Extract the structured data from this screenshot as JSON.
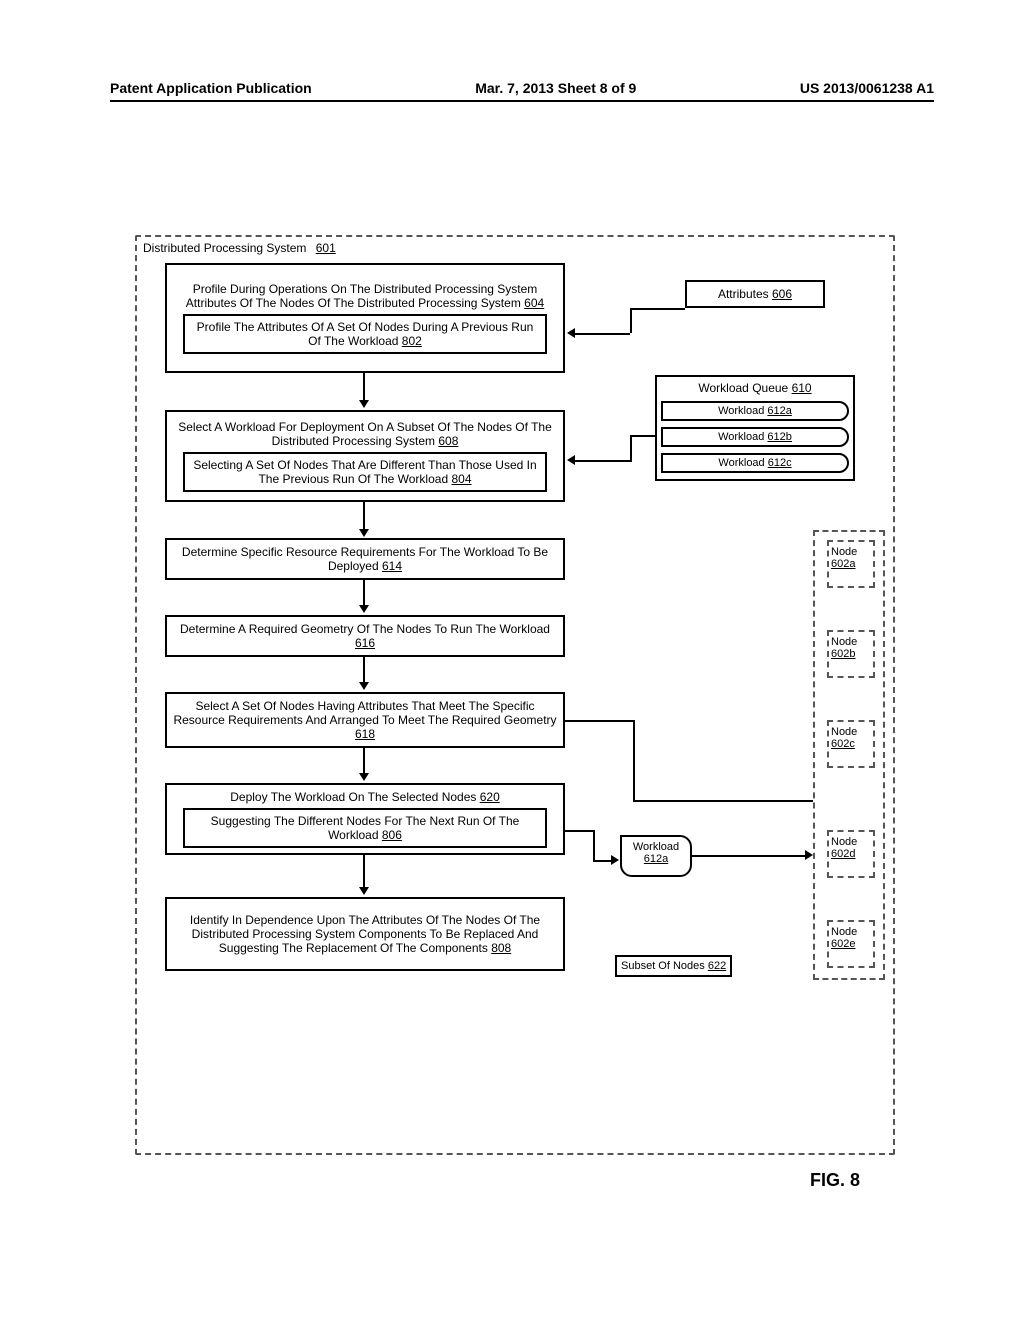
{
  "header": {
    "left": "Patent Application Publication",
    "center": "Mar. 7, 2013  Sheet 8 of 9",
    "right": "US 2013/0061238 A1"
  },
  "system_label": "Distributed Processing System",
  "system_ref": "601",
  "boxes": {
    "b604": "Profile During Operations On The Distributed Processing System Attributes Of The Nodes Of The Distributed Processing System",
    "b604_ref": "604",
    "b802": "Profile The Attributes Of A Set Of Nodes During A Previous Run Of The Workload",
    "b802_ref": "802",
    "b608": "Select A Workload For Deployment On A Subset Of The Nodes Of The Distributed Processing System",
    "b608_ref": "608",
    "b804": "Selecting A Set Of Nodes That Are Different Than Those Used In The Previous Run Of The Workload",
    "b804_ref": "804",
    "b614": "Determine Specific Resource Requirements For The Workload To Be Deployed",
    "b614_ref": "614",
    "b616": "Determine A Required Geometry Of The Nodes To Run The Workload",
    "b616_ref": "616",
    "b618": "Select A Set Of Nodes Having Attributes That Meet The Specific Resource Requirements And Arranged To Meet The Required Geometry",
    "b618_ref": "618",
    "b620": "Deploy The Workload On The Selected Nodes",
    "b620_ref": "620",
    "b806": "Suggesting The Different Nodes For The Next Run Of The Workload",
    "b806_ref": "806",
    "b808": "Identify In Dependence Upon The Attributes Of The Nodes Of The Distributed Processing System Components To Be Replaced And Suggesting The Replacement Of The Components",
    "b808_ref": "808"
  },
  "attributes": {
    "label": "Attributes",
    "ref": "606"
  },
  "queue": {
    "label": "Workload Queue",
    "ref": "610",
    "items": [
      {
        "label": "Workload",
        "ref": "612a"
      },
      {
        "label": "Workload",
        "ref": "612b"
      },
      {
        "label": "Workload",
        "ref": "612c"
      }
    ]
  },
  "nodes": {
    "a": {
      "label": "Node",
      "ref": "602a"
    },
    "b": {
      "label": "Node",
      "ref": "602b"
    },
    "c": {
      "label": "Node",
      "ref": "602c"
    },
    "d": {
      "label": "Node",
      "ref": "602d"
    },
    "e": {
      "label": "Node",
      "ref": "602e"
    }
  },
  "workload_par": {
    "label": "Workload",
    "ref": "612a"
  },
  "subset": {
    "label": "Subset Of Nodes",
    "ref": "622"
  },
  "fig": "FIG. 8"
}
